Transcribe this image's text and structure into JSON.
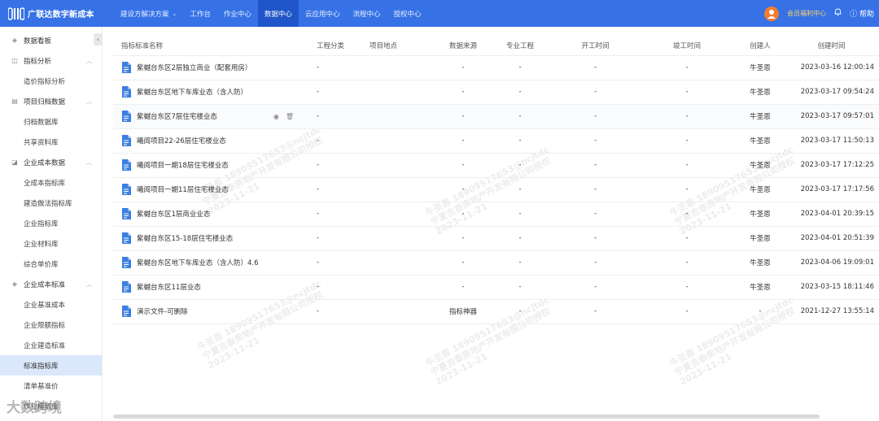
{
  "app": {
    "brand": "广联达数字新成本",
    "colors": {
      "topbar": "#3672e6",
      "active_nav": "#1f55c8",
      "active_sidebar": "#dbe7fb",
      "file_icon": "#3b7fe0"
    }
  },
  "nav": {
    "items": [
      {
        "label": "建设方解决方案",
        "has_dropdown": true
      },
      {
        "label": "工作台"
      },
      {
        "label": "作业中心"
      },
      {
        "label": "数据中心",
        "active": true
      },
      {
        "label": "云应用中心"
      },
      {
        "label": "流程中心"
      },
      {
        "label": "授权中心"
      }
    ],
    "member_label": "会员福利中心",
    "help_label": "帮助",
    "icons": {
      "member": "avatar-icon",
      "bell": "bell-icon",
      "help": "help-circle-icon"
    }
  },
  "sidebar": {
    "collapse_icon": "‹",
    "items": [
      {
        "type": "group",
        "label": "数据看板",
        "icon": "layers-icon"
      },
      {
        "type": "group",
        "label": "指标分析",
        "icon": "chart-icon",
        "expanded": true
      },
      {
        "type": "child",
        "label": "造价指标分析"
      },
      {
        "type": "group",
        "label": "项目归档数据",
        "icon": "archive-icon",
        "expanded": true
      },
      {
        "type": "child",
        "label": "归档数据库"
      },
      {
        "type": "child",
        "label": "共享资料库"
      },
      {
        "type": "group",
        "label": "企业成本数据",
        "icon": "trend-icon",
        "expanded": true
      },
      {
        "type": "child",
        "label": "全成本指标库"
      },
      {
        "type": "child",
        "label": "建造做法指标库"
      },
      {
        "type": "child",
        "label": "企业指标库"
      },
      {
        "type": "child",
        "label": "企业材料库"
      },
      {
        "type": "child",
        "label": "综合单价库"
      },
      {
        "type": "group",
        "label": "企业成本标准",
        "icon": "layers-icon",
        "expanded": true
      },
      {
        "type": "child",
        "label": "企业基准成本"
      },
      {
        "type": "child",
        "label": "企业限额指标"
      },
      {
        "type": "child",
        "label": "企业建造标准"
      },
      {
        "type": "child",
        "label": "标准指标库",
        "active": true
      },
      {
        "type": "child",
        "label": "清单基准价"
      },
      {
        "type": "child",
        "label": "作业模版库"
      }
    ]
  },
  "table": {
    "headers": {
      "name": "指标标准名称",
      "category": "工程分类",
      "location": "项目地点",
      "source": "数据来源",
      "professional": "专业工程",
      "start": "开工时间",
      "end": "竣工时间",
      "creator": "创建人",
      "created": "创建时间"
    },
    "rows": [
      {
        "name": "紫樾台东区2层独立商业（配套用房）",
        "category": "-",
        "location": "",
        "source": "-",
        "professional": "-",
        "start": "-",
        "end": "-",
        "creator": "牛圣恩",
        "created": "2023-03-16 12:00:14"
      },
      {
        "name": "紫樾台东区地下车库业态（含人防）",
        "category": "-",
        "location": "",
        "source": "-",
        "professional": "-",
        "start": "-",
        "end": "-",
        "creator": "牛圣恩",
        "created": "2023-03-17 09:54:24"
      },
      {
        "name": "紫樾台东区7层住宅楼业态",
        "category": "-",
        "location": "",
        "source": "-",
        "professional": "-",
        "start": "-",
        "end": "-",
        "creator": "牛圣恩",
        "created": "2023-03-17 09:57:01",
        "hover": true
      },
      {
        "name": "曦阅项目22-26层住宅楼业态",
        "category": "-",
        "location": "",
        "source": "-",
        "professional": "-",
        "start": "-",
        "end": "-",
        "creator": "牛圣恩",
        "created": "2023-03-17 11:50:13"
      },
      {
        "name": "曦阅项目一期18层住宅楼业态",
        "category": "-",
        "location": "",
        "source": "-",
        "professional": "-",
        "start": "-",
        "end": "-",
        "creator": "牛圣恩",
        "created": "2023-03-17 17:12:25"
      },
      {
        "name": "曦阅项目一期11层住宅楼业态",
        "category": "-",
        "location": "",
        "source": "-",
        "professional": "-",
        "start": "-",
        "end": "-",
        "creator": "牛圣恩",
        "created": "2023-03-17 17:17:56"
      },
      {
        "name": "紫樾台东区1层商业业态",
        "category": "-",
        "location": "",
        "source": "-",
        "professional": "-",
        "start": "-",
        "end": "-",
        "creator": "牛圣恩",
        "created": "2023-04-01 20:39:15"
      },
      {
        "name": "紫樾台东区15-18层住宅楼业态",
        "category": "-",
        "location": "",
        "source": "-",
        "professional": "-",
        "start": "-",
        "end": "-",
        "creator": "牛圣恩",
        "created": "2023-04-01 20:51:39"
      },
      {
        "name": "紫樾台东区地下车库业态（含人防）4.6",
        "category": "-",
        "location": "",
        "source": "-",
        "professional": "-",
        "start": "-",
        "end": "-",
        "creator": "牛圣恩",
        "created": "2023-04-06 19:09:01"
      },
      {
        "name": "紫樾台东区11层业态",
        "category": "-",
        "location": "",
        "source": "-",
        "professional": "-",
        "start": "-",
        "end": "-",
        "creator": "牛圣恩",
        "created": "2023-03-15 18:11:46"
      },
      {
        "name": "演示文件-可删除",
        "category": "-",
        "location": "",
        "source": "指标神器",
        "professional": "-",
        "start": "-",
        "end": "-",
        "creator": "-",
        "created": "2021-12-27 13:55:14"
      }
    ],
    "row_action_icons": [
      "eye-icon",
      "trash-icon"
    ]
  },
  "watermarks": [
    {
      "line1": "牛圣恩 18909517653@ncjtdc",
      "line2": "宁夏吉泰房地产开发有限公司授权",
      "line3": "2023-11-21"
    }
  ],
  "brand_watermark": "大数跨境"
}
